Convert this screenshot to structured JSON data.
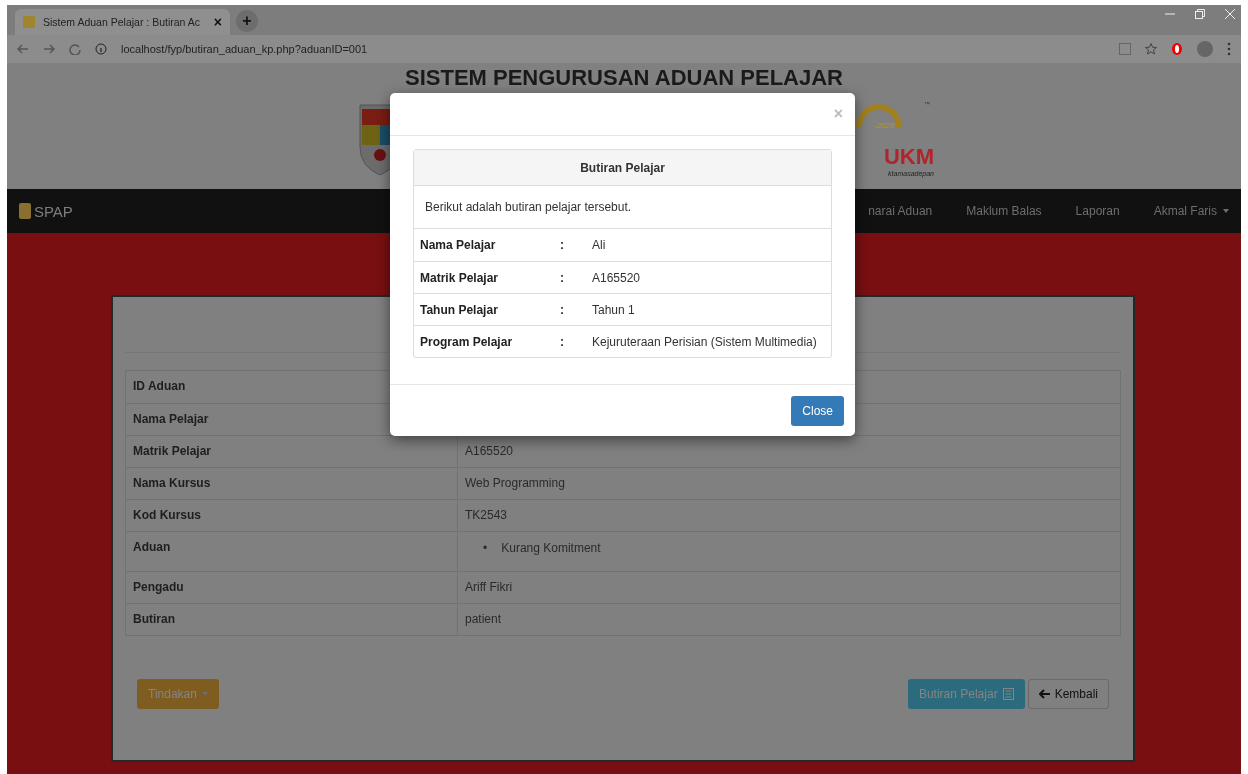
{
  "browser": {
    "tab_title": "Sistem Aduan Pelajar : Butiran Ac",
    "tab_close": "×",
    "new_tab": "+",
    "url": "localhost/fyp/butiran_aduan_kp.php?aduanID=001"
  },
  "header": {
    "title": "SISTEM PENGURUSAN ADUAN PELAJAR",
    "logo_year": "-2020",
    "logo_text": "UKM",
    "logo_tm": "™",
    "logo_tagline": "ktamasadepan"
  },
  "navbar": {
    "brand": "SPAP",
    "items": [
      {
        "label": "narai Aduan",
        "dropdown": false
      },
      {
        "label": "Maklum Balas",
        "dropdown": false
      },
      {
        "label": "Laporan",
        "dropdown": false
      },
      {
        "label": "Akmal Faris",
        "dropdown": true
      }
    ]
  },
  "details": [
    {
      "label": "ID Aduan"
    },
    {
      "label": "Nama Pelajar"
    },
    {
      "label": "Matrik Pelajar",
      "value": "A165520"
    },
    {
      "label": "Nama Kursus",
      "value": "Web Programming"
    },
    {
      "label": "Kod Kursus",
      "value": "TK2543"
    },
    {
      "label": "Aduan",
      "bullet": "•",
      "items": [
        "Kurang Komitment"
      ]
    },
    {
      "label": "Pengadu",
      "value": "Ariff Fikri"
    },
    {
      "label": "Butiran",
      "value": "patient"
    }
  ],
  "actions": {
    "tindakan": "Tindakan",
    "butiran": "Butiran Pelajar",
    "kembali": "Kembali"
  },
  "modal": {
    "close_x": "×",
    "panel_title": "Butiran Pelajar",
    "intro": "Berikut adalah butiran pelajar tersebut.",
    "rows": [
      {
        "label": "Nama Pelajar",
        "sep": ":",
        "value": "Ali"
      },
      {
        "label": "Matrik Pelajar",
        "sep": ":",
        "value": "A165520"
      },
      {
        "label": "Tahun Pelajar",
        "sep": ":",
        "value": "Tahun 1"
      },
      {
        "label": "Program Pelajar",
        "sep": ":",
        "value": "Kejuruteraan Perisian (Sistem Multimedia)"
      }
    ],
    "close_button": "Close"
  }
}
